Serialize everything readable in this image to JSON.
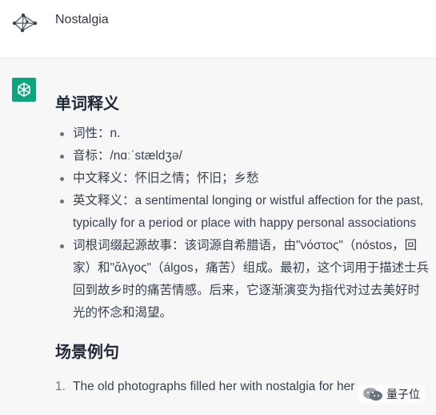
{
  "user": {
    "message": "Nostalgia"
  },
  "response": {
    "section1_title": "单词释义",
    "items": [
      "词性：n.",
      "音标：/nɑːˈstældʒə/",
      "中文释义：怀旧之情；怀旧；乡愁",
      "英文释义：a sentimental longing or wistful affection for the past, typically for a period or place with happy personal associations",
      "词根词缀起源故事：该词源自希腊语，由\"νόστος\"（nóstos，回家）和\"ἄλγος\"（álgos，痛苦）组成。最初，这个词用于描述士兵回到故乡时的痛苦情感。后来，它逐渐演变为指代对过去美好时光的怀念和渴望。"
    ],
    "section2_title": "场景例句",
    "examples": [
      {
        "num": "1.",
        "text": "The old photographs filled her with nostalgia for her"
      }
    ]
  },
  "watermark": {
    "text": "量子位"
  },
  "colors": {
    "gpt_green": "#10a37f",
    "assistant_bg": "#f7f7f8"
  }
}
